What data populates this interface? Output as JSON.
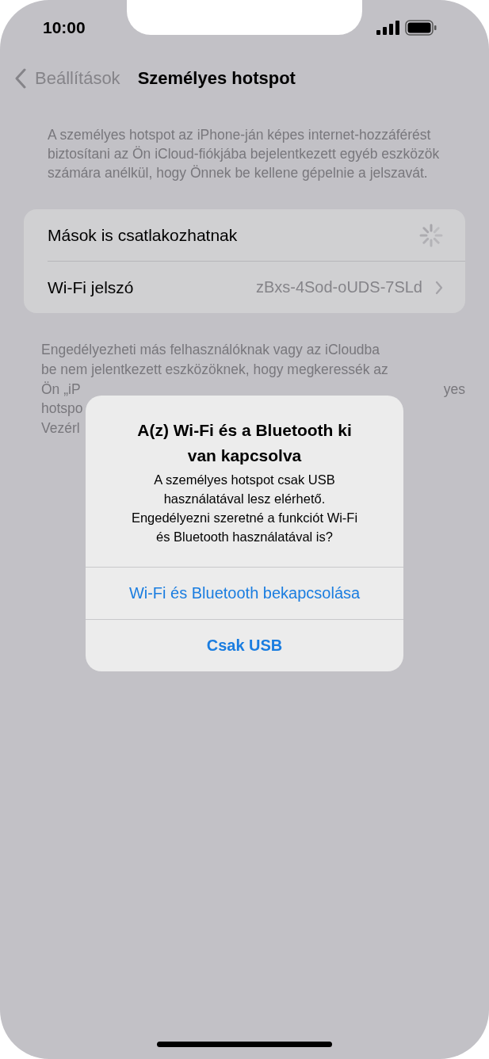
{
  "status_bar": {
    "time": "10:00"
  },
  "nav": {
    "back": "Beállítások",
    "title": "Személyes hotspot"
  },
  "description": "A személyes hotspot az iPhone-ján képes internet-hozzáférést biztosítani az Ön iCloud-fiókjába bejelentkezett egyéb eszközök számára anélkül, hogy Önnek be kellene gépelnie a jelszavát.",
  "settings": [
    {
      "kind": "spinner",
      "label": "Mások is csatlakozhatnak"
    },
    {
      "kind": "link",
      "label": "Wi-Fi jelszó",
      "value": "zBxs-4Sod-oUDS-7SLd"
    }
  ],
  "footer_lines": [
    {
      "left": "Engedélyezheti más felhasználóknak vagy az iCloudba"
    },
    {
      "left": "be nem jelentkezett eszközöknek, hogy megkeressék az"
    },
    {
      "left": "Ön „iP",
      "right": "yes"
    },
    {
      "left": "hotspo"
    },
    {
      "left": "Vezérl"
    }
  ],
  "alert": {
    "title": "A(z) Wi-Fi és a Bluetooth ki van kapcsolva",
    "message": "A személyes hotspot csak USB használatával lesz elérhető. Engedélyezni szeretné a funkciót Wi-Fi és Bluetooth használatával is?",
    "buttons": [
      {
        "label": "Wi-Fi és Bluetooth bekapcsolása",
        "bold": false
      },
      {
        "label": "Csak USB",
        "bold": true
      }
    ]
  }
}
